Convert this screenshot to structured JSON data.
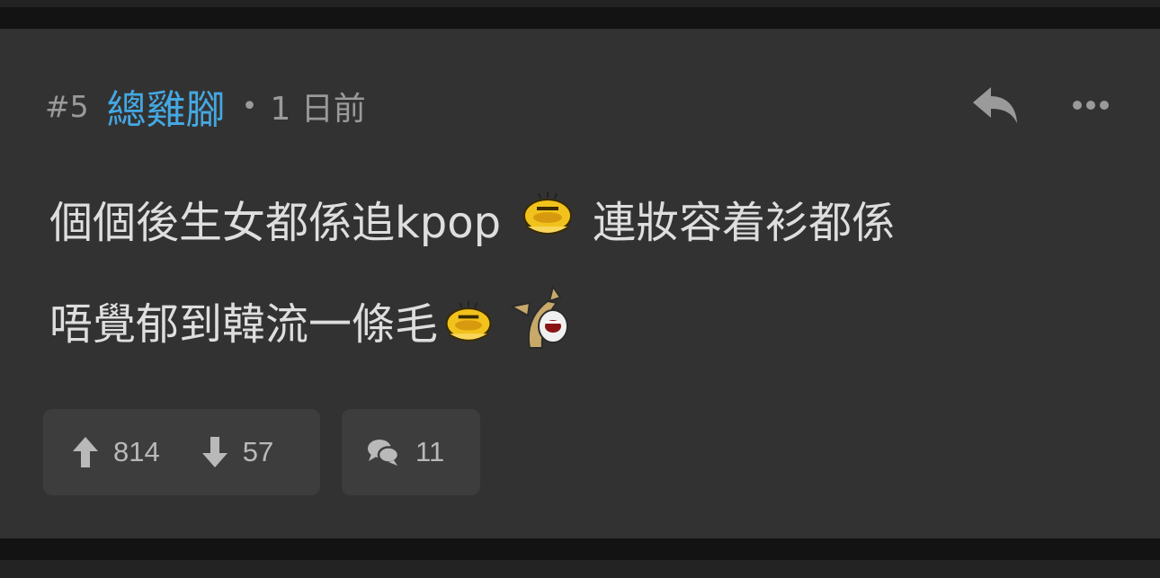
{
  "post": {
    "floor": "#5",
    "username": "總雞腳",
    "separator": "•",
    "time": "1 日前",
    "line1_a": "個個後生女都係追kpop",
    "line1_b": "連妝容着衫都係",
    "line2": "唔覺郁到韓流一條毛",
    "upvotes": "814",
    "downvotes": "57",
    "comment_count": "11"
  },
  "icons": {
    "reply": "reply-icon",
    "more": "more-dots-icon",
    "upvote": "arrow-up-icon",
    "downvote": "arrow-down-icon",
    "comment": "comment-bubble-icon",
    "emoji1": "yellow-face-sticker",
    "emoji2": "crying-horse-sticker"
  },
  "colors": {
    "username": "#44a8e2",
    "background": "#333232",
    "chip": "#3e3d3d",
    "text": "#dedede",
    "muted": "#9a9a9a"
  }
}
